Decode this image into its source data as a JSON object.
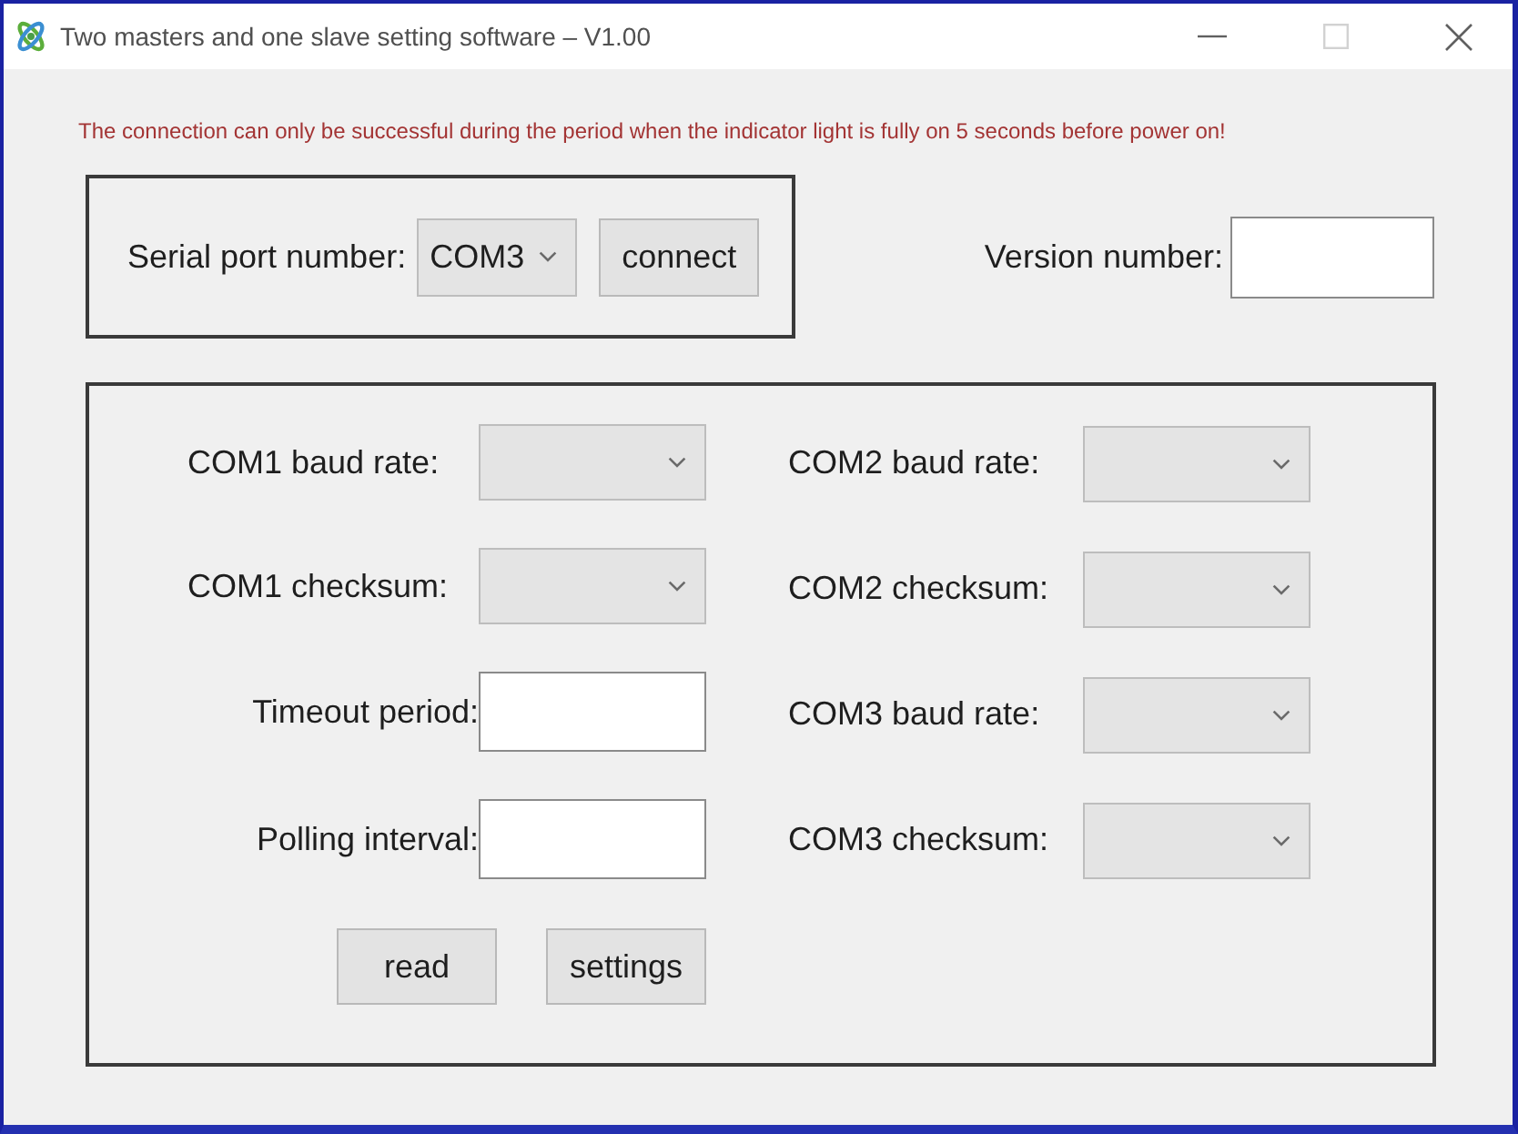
{
  "window": {
    "title": "Two masters and one slave setting software – V1.00",
    "controls": [
      {
        "kind": "minimize",
        "disabled": false
      },
      {
        "kind": "maximize",
        "disabled": true
      },
      {
        "kind": "close",
        "disabled": false
      }
    ]
  },
  "notice": "The connection can only be successful during the period when the indicator light is fully on 5 seconds before power on!",
  "connection": {
    "port_label": "Serial port number:",
    "port_value": "COM3",
    "connect_button": "connect"
  },
  "version": {
    "label": "Version number:"
  },
  "settings": {
    "left_column": [
      {
        "kind": "combo",
        "label": "COM1 baud rate:"
      },
      {
        "kind": "combo",
        "label": "COM1 checksum:"
      },
      {
        "kind": "text",
        "label": "Timeout period:"
      },
      {
        "kind": "text",
        "label": "Polling interval:"
      }
    ],
    "right_column": [
      {
        "kind": "combo",
        "label": "COM2 baud rate:"
      },
      {
        "kind": "combo",
        "label": "COM2 checksum:"
      },
      {
        "kind": "combo",
        "label": "COM3 baud rate:"
      },
      {
        "kind": "combo",
        "label": "COM3 checksum:"
      }
    ],
    "buttons": [
      "read",
      "settings"
    ]
  }
}
